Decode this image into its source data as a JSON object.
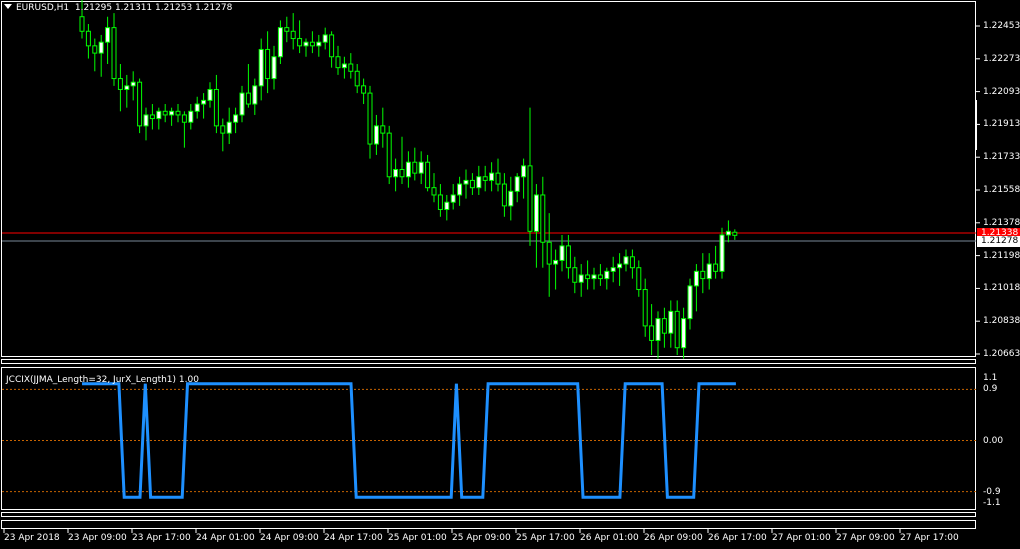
{
  "main_header": {
    "symbol": "EURUSD,H1",
    "ohlc": "1.21295 1.21311 1.21253 1.21278"
  },
  "indicator_header": {
    "text": "JCCIX(JJMA_Length=32, JurX_Length1) 1.00"
  },
  "price_axis": {
    "ticks": [
      "1.22453",
      "1.22273",
      "1.22093",
      "1.21913",
      "1.21733",
      "1.21558",
      "1.21378",
      "1.21198",
      "1.21018",
      "1.20838",
      "1.20663"
    ],
    "ask_tag": "1.21338",
    "bid_tag": "1.21278"
  },
  "indicator_axis": {
    "ticks": [
      "1.1",
      "0.9",
      "0.00",
      "-0.9",
      "-1.1"
    ]
  },
  "time_axis": {
    "ticks": [
      "23 Apr 2018",
      "23 Apr 09:00",
      "23 Apr 17:00",
      "24 Apr 01:00",
      "24 Apr 09:00",
      "24 Apr 17:00",
      "25 Apr 01:00",
      "25 Apr 09:00",
      "25 Apr 17:00",
      "26 Apr 01:00",
      "26 Apr 09:00",
      "26 Apr 17:00",
      "27 Apr 01:00",
      "27 Apr 09:00",
      "27 Apr 17:00"
    ]
  },
  "colors": {
    "background": "#000000",
    "bull_candle": "#ffffff",
    "bear_candle": "#000000",
    "wick": "#00ff00",
    "ask_line": "#ff0000",
    "bid_line": "#778899",
    "indicator_line": "#1e90ff",
    "level_line": "#c86400"
  },
  "chart_data": [
    {
      "type": "candlestick",
      "title": "EURUSD,H1",
      "ylim": [
        1.2062,
        1.2255
      ],
      "candles": [
        [
          1.2248,
          1.2262,
          1.2236,
          1.224
        ],
        [
          1.224,
          1.2244,
          1.2225,
          1.2232
        ],
        [
          1.2232,
          1.2236,
          1.2218,
          1.2228
        ],
        [
          1.2228,
          1.2238,
          1.2215,
          1.2234
        ],
        [
          1.2234,
          1.2248,
          1.2222,
          1.2242
        ],
        [
          1.2242,
          1.225,
          1.221,
          1.2214
        ],
        [
          1.2214,
          1.2222,
          1.2196,
          1.2208
        ],
        [
          1.2208,
          1.2216,
          1.2198,
          1.221
        ],
        [
          1.221,
          1.2218,
          1.2202,
          1.2212
        ],
        [
          1.2212,
          1.2214,
          1.2184,
          1.2188
        ],
        [
          1.2188,
          1.2198,
          1.218,
          1.2194
        ],
        [
          1.2194,
          1.22,
          1.2186,
          1.2192
        ],
        [
          1.2192,
          1.2198,
          1.2186,
          1.2196
        ],
        [
          1.2196,
          1.22,
          1.219,
          1.2194
        ],
        [
          1.2194,
          1.2198,
          1.2188,
          1.2196
        ],
        [
          1.2196,
          1.22,
          1.219,
          1.2194
        ],
        [
          1.2194,
          1.2196,
          1.2176,
          1.219
        ],
        [
          1.219,
          1.22,
          1.2186,
          1.2196
        ],
        [
          1.2196,
          1.2204,
          1.2192,
          1.22
        ],
        [
          1.22,
          1.2206,
          1.2192,
          1.2202
        ],
        [
          1.2202,
          1.2212,
          1.2198,
          1.2208
        ],
        [
          1.2208,
          1.2216,
          1.2184,
          1.2188
        ],
        [
          1.2188,
          1.2192,
          1.2174,
          1.2184
        ],
        [
          1.2184,
          1.2198,
          1.2178,
          1.219
        ],
        [
          1.219,
          1.2198,
          1.2184,
          1.2194
        ],
        [
          1.2194,
          1.221,
          1.219,
          1.2206
        ],
        [
          1.2206,
          1.2222,
          1.2198,
          1.22
        ],
        [
          1.22,
          1.2214,
          1.2194,
          1.221
        ],
        [
          1.221,
          1.2236,
          1.2202,
          1.223
        ],
        [
          1.223,
          1.224,
          1.2206,
          1.2214
        ],
        [
          1.2214,
          1.2232,
          1.2208,
          1.2226
        ],
        [
          1.2226,
          1.2246,
          1.2222,
          1.2242
        ],
        [
          1.2242,
          1.2248,
          1.2234,
          1.224
        ],
        [
          1.224,
          1.225,
          1.223,
          1.2236
        ],
        [
          1.2236,
          1.2246,
          1.2228,
          1.2232
        ],
        [
          1.2232,
          1.2236,
          1.2226,
          1.2234
        ],
        [
          1.2234,
          1.224,
          1.2228,
          1.2232
        ],
        [
          1.2232,
          1.2238,
          1.2226,
          1.2234
        ],
        [
          1.2234,
          1.2242,
          1.223,
          1.2238
        ],
        [
          1.2238,
          1.224,
          1.222,
          1.2226
        ],
        [
          1.2226,
          1.2232,
          1.2216,
          1.222
        ],
        [
          1.222,
          1.2226,
          1.2214,
          1.2222
        ],
        [
          1.2222,
          1.2228,
          1.2214,
          1.2218
        ],
        [
          1.2218,
          1.2222,
          1.2206,
          1.221
        ],
        [
          1.221,
          1.2214,
          1.22,
          1.2206
        ],
        [
          1.2206,
          1.221,
          1.217,
          1.2178
        ],
        [
          1.2178,
          1.2194,
          1.2172,
          1.2188
        ],
        [
          1.2188,
          1.2198,
          1.2176,
          1.2184
        ],
        [
          1.2184,
          1.2188,
          1.2156,
          1.216
        ],
        [
          1.216,
          1.217,
          1.2152,
          1.2164
        ],
        [
          1.2164,
          1.2182,
          1.2156,
          1.216
        ],
        [
          1.216,
          1.2174,
          1.2154,
          1.2168
        ],
        [
          1.2168,
          1.2176,
          1.2158,
          1.2162
        ],
        [
          1.2162,
          1.2174,
          1.2156,
          1.2168
        ],
        [
          1.2168,
          1.2172,
          1.2152,
          1.2154
        ],
        [
          1.2154,
          1.2162,
          1.2146,
          1.215
        ],
        [
          1.215,
          1.2156,
          1.2138,
          1.2142
        ],
        [
          1.2142,
          1.215,
          1.2136,
          1.2146
        ],
        [
          1.2146,
          1.2156,
          1.2142,
          1.215
        ],
        [
          1.215,
          1.216,
          1.2144,
          1.2156
        ],
        [
          1.2156,
          1.2164,
          1.2148,
          1.2158
        ],
        [
          1.2158,
          1.2162,
          1.215,
          1.2154
        ],
        [
          1.2154,
          1.2166,
          1.215,
          1.216
        ],
        [
          1.216,
          1.2166,
          1.2152,
          1.2158
        ],
        [
          1.2158,
          1.2168,
          1.2152,
          1.2162
        ],
        [
          1.2162,
          1.217,
          1.2152,
          1.2156
        ],
        [
          1.2156,
          1.2162,
          1.2138,
          1.2144
        ],
        [
          1.2144,
          1.216,
          1.2136,
          1.2152
        ],
        [
          1.2152,
          1.2162,
          1.2146,
          1.216
        ],
        [
          1.216,
          1.217,
          1.2148,
          1.2166
        ],
        [
          1.2166,
          1.2198,
          1.2122,
          1.213
        ],
        [
          1.213,
          1.2156,
          1.211,
          1.215
        ],
        [
          1.215,
          1.216,
          1.211,
          1.2124
        ],
        [
          1.2124,
          1.214,
          1.2094,
          1.2112
        ],
        [
          1.2112,
          1.212,
          1.2098,
          1.2114
        ],
        [
          1.2114,
          1.2128,
          1.2108,
          1.2122
        ],
        [
          1.2122,
          1.2128,
          1.2104,
          1.211
        ],
        [
          1.211,
          1.2116,
          1.2096,
          1.2102
        ],
        [
          1.2102,
          1.2112,
          1.2094,
          1.2106
        ],
        [
          1.2106,
          1.2114,
          1.2098,
          1.2104
        ],
        [
          1.2104,
          1.211,
          1.2098,
          1.2106
        ],
        [
          1.2106,
          1.2112,
          1.21,
          1.2104
        ],
        [
          1.2104,
          1.211,
          1.2098,
          1.2108
        ],
        [
          1.2108,
          1.2116,
          1.2102,
          1.211
        ],
        [
          1.211,
          1.2118,
          1.21,
          1.2112
        ],
        [
          1.2112,
          1.212,
          1.2108,
          1.2116
        ],
        [
          1.2116,
          1.212,
          1.2104,
          1.211
        ],
        [
          1.211,
          1.2114,
          1.2094,
          1.2098
        ],
        [
          1.2098,
          1.2104,
          1.2072,
          1.2078
        ],
        [
          1.2078,
          1.209,
          1.2062,
          1.207
        ],
        [
          1.207,
          1.2086,
          1.206,
          1.2082
        ],
        [
          1.2082,
          1.2088,
          1.2066,
          1.2074
        ],
        [
          1.2074,
          1.2092,
          1.2066,
          1.2086
        ],
        [
          1.2086,
          1.2092,
          1.2062,
          1.2066
        ],
        [
          1.2066,
          1.2088,
          1.206,
          1.2082
        ],
        [
          1.2082,
          1.2104,
          1.2076,
          1.21
        ],
        [
          1.21,
          1.2112,
          1.2086,
          1.2108
        ],
        [
          1.2108,
          1.2118,
          1.2096,
          1.2104
        ],
        [
          1.2104,
          1.2118,
          1.2098,
          1.2112
        ],
        [
          1.2112,
          1.2122,
          1.2104,
          1.2108
        ],
        [
          1.2108,
          1.2132,
          1.2104,
          1.2128
        ],
        [
          1.2128,
          1.2136,
          1.2124,
          1.213
        ],
        [
          1.21295,
          1.21311,
          1.21253,
          1.21278
        ]
      ]
    },
    {
      "type": "line",
      "title": "JCCIX(JJMA_Length=32, JurX_Length1) 1.00",
      "ylim": [
        -1.1,
        1.1
      ],
      "levels": [
        0.9,
        0.0,
        -0.9
      ],
      "series": [
        {
          "values": [
            1.0,
            1.0,
            1.0,
            1.0,
            1.0,
            1.0,
            1.0,
            1.0,
            -1.0,
            -1.0,
            -1.0,
            -1.0,
            1.0,
            -1.0,
            -1.0,
            -1.0,
            -1.0,
            -1.0,
            -1.0,
            -1.0,
            1.0,
            1.0,
            1.0,
            1.0,
            1.0,
            1.0,
            1.0,
            1.0,
            1.0,
            1.0,
            1.0,
            1.0,
            1.0,
            1.0,
            1.0,
            1.0,
            1.0,
            1.0,
            1.0,
            1.0,
            1.0,
            1.0,
            1.0,
            1.0,
            1.0,
            1.0,
            1.0,
            1.0,
            1.0,
            1.0,
            1.0,
            1.0,
            -1.0,
            -1.0,
            -1.0,
            -1.0,
            -1.0,
            -1.0,
            -1.0,
            -1.0,
            -1.0,
            -1.0,
            -1.0,
            -1.0,
            -1.0,
            -1.0,
            -1.0,
            -1.0,
            -1.0,
            -1.0,
            -1.0,
            1.0,
            -1.0,
            -1.0,
            -1.0,
            -1.0,
            -1.0,
            1.0,
            1.0,
            1.0,
            1.0,
            1.0,
            1.0,
            1.0,
            1.0,
            1.0,
            1.0,
            1.0,
            1.0,
            1.0,
            1.0,
            1.0,
            1.0,
            1.0,
            1.0,
            -1.0,
            -1.0,
            -1.0,
            -1.0,
            -1.0,
            -1.0,
            -1.0,
            -1.0,
            1.0,
            1.0,
            1.0,
            1.0,
            1.0,
            1.0,
            1.0,
            1.0,
            -1.0,
            -1.0,
            -1.0,
            -1.0,
            -1.0,
            -1.0,
            1.0,
            1.0,
            1.0,
            1.0,
            1.0,
            1.0,
            1.0,
            1.0
          ]
        }
      ]
    }
  ]
}
